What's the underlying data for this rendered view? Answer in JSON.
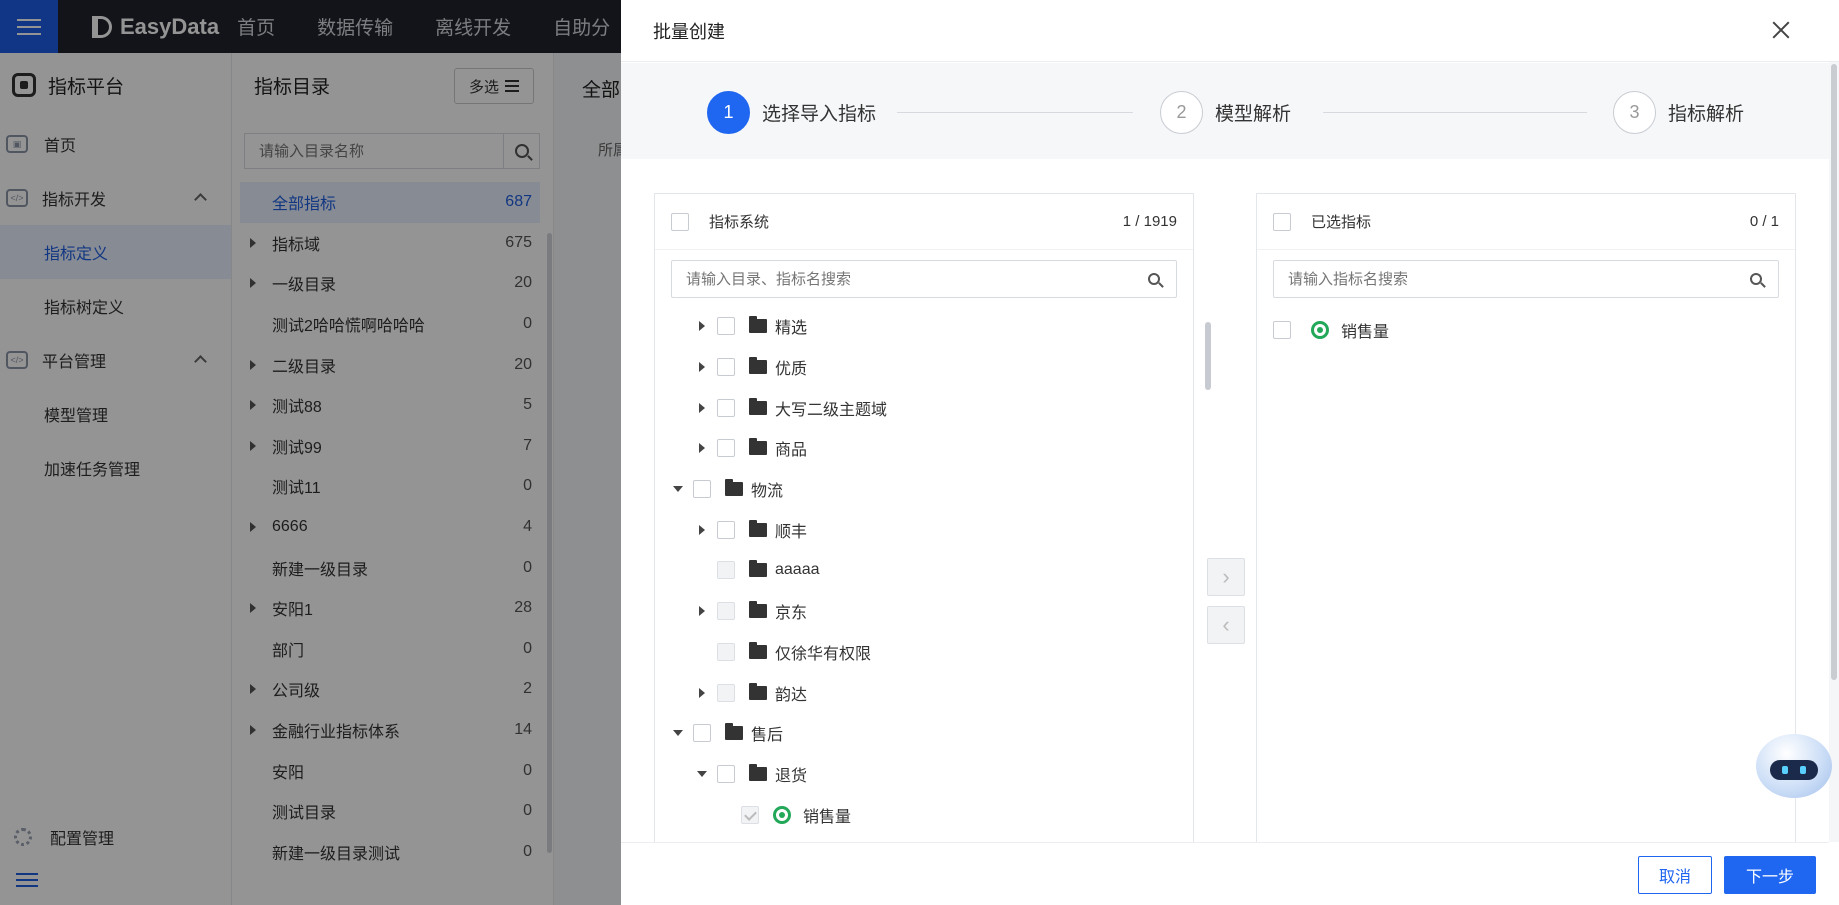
{
  "topbar": {
    "brand": "EasyData",
    "nav": [
      "首页",
      "数据传输",
      "离线开发",
      "自助分"
    ]
  },
  "sidebar": {
    "title": "指标平台",
    "items": [
      {
        "label": "首页",
        "type": "item",
        "icon": "home-icon"
      },
      {
        "label": "指标开发",
        "type": "group",
        "icon": "code-icon"
      },
      {
        "label": "指标定义",
        "type": "child",
        "active": true
      },
      {
        "label": "指标树定义",
        "type": "child"
      },
      {
        "label": "平台管理",
        "type": "group",
        "icon": "code-icon"
      },
      {
        "label": "模型管理",
        "type": "child"
      },
      {
        "label": "加速任务管理",
        "type": "child"
      }
    ],
    "bottom": "配置管理"
  },
  "directory": {
    "title": "指标目录",
    "multi_select": "多选",
    "search_placeholder": "请输入目录名称",
    "rows": [
      {
        "label": "全部指标",
        "count": "687",
        "expandable": false,
        "selected": true
      },
      {
        "label": "指标域",
        "count": "675",
        "expandable": true
      },
      {
        "label": "一级目录",
        "count": "20",
        "expandable": true
      },
      {
        "label": "测试2哈哈慌啊哈哈哈",
        "count": "0",
        "expandable": false
      },
      {
        "label": "二级目录",
        "count": "20",
        "expandable": true
      },
      {
        "label": "测试88",
        "count": "5",
        "expandable": true
      },
      {
        "label": "测试99",
        "count": "7",
        "expandable": true
      },
      {
        "label": "测试11",
        "count": "0",
        "expandable": false
      },
      {
        "label": "6666",
        "count": "4",
        "expandable": true
      },
      {
        "label": "新建一级目录",
        "count": "0",
        "expandable": false
      },
      {
        "label": "安阳1",
        "count": "28",
        "expandable": true
      },
      {
        "label": "部门",
        "count": "0",
        "expandable": false
      },
      {
        "label": "公司级",
        "count": "2",
        "expandable": true
      },
      {
        "label": "金融行业指标体系",
        "count": "14",
        "expandable": true
      },
      {
        "label": "安阳",
        "count": "0",
        "expandable": false
      },
      {
        "label": "测试目录",
        "count": "0",
        "expandable": false
      },
      {
        "label": "新建一级目录测试",
        "count": "0",
        "expandable": false
      }
    ]
  },
  "content": {
    "title": "全部",
    "sub": "所属"
  },
  "drawer": {
    "title": "批量创建",
    "steps": [
      {
        "num": "1",
        "label": "选择导入指标",
        "active": true
      },
      {
        "num": "2",
        "label": "模型解析",
        "active": false
      },
      {
        "num": "3",
        "label": "指标解析",
        "active": false
      }
    ],
    "left": {
      "title": "指标系统",
      "count": "1 / 1919",
      "search_placeholder": "请输入目录、指标名搜索",
      "tree": [
        {
          "label": "精选",
          "level": 2,
          "arrow": "r",
          "kind": "folder",
          "cb": "normal"
        },
        {
          "label": "优质",
          "level": 2,
          "arrow": "r",
          "kind": "folder",
          "cb": "normal"
        },
        {
          "label": "大写二级主题域",
          "level": 2,
          "arrow": "r",
          "kind": "folder",
          "cb": "normal"
        },
        {
          "label": "商品",
          "level": 2,
          "arrow": "r",
          "kind": "folder",
          "cb": "normal"
        },
        {
          "label": "物流",
          "level": 1,
          "arrow": "d",
          "kind": "folder",
          "cb": "normal"
        },
        {
          "label": "顺丰",
          "level": 2,
          "arrow": "r",
          "kind": "folder",
          "cb": "normal"
        },
        {
          "label": "aaaaa",
          "level": 2,
          "arrow": "n",
          "kind": "folder",
          "cb": "dis"
        },
        {
          "label": "京东",
          "level": 2,
          "arrow": "r",
          "kind": "folder",
          "cb": "dis"
        },
        {
          "label": "仅徐华有权限",
          "level": 2,
          "arrow": "n",
          "kind": "folder",
          "cb": "dis"
        },
        {
          "label": "韵达",
          "level": 2,
          "arrow": "r",
          "kind": "folder",
          "cb": "dis"
        },
        {
          "label": "售后",
          "level": 1,
          "arrow": "d",
          "kind": "folder",
          "cb": "normal"
        },
        {
          "label": "退货",
          "level": 2,
          "arrow": "d",
          "kind": "folder",
          "cb": "normal"
        },
        {
          "label": "销售量",
          "level": 3,
          "arrow": "n",
          "kind": "metric",
          "cb": "checked-dis"
        }
      ]
    },
    "right": {
      "title": "已选指标",
      "count": "0 / 1",
      "search_placeholder": "请输入指标名搜索",
      "items": [
        "销售量"
      ]
    },
    "transfer_right": "›",
    "transfer_left": "‹",
    "cancel": "取消",
    "next": "下一步"
  },
  "colors": {
    "primary": "#1f66f0",
    "topbar": "#1f232b",
    "metric": "#23a85a"
  }
}
